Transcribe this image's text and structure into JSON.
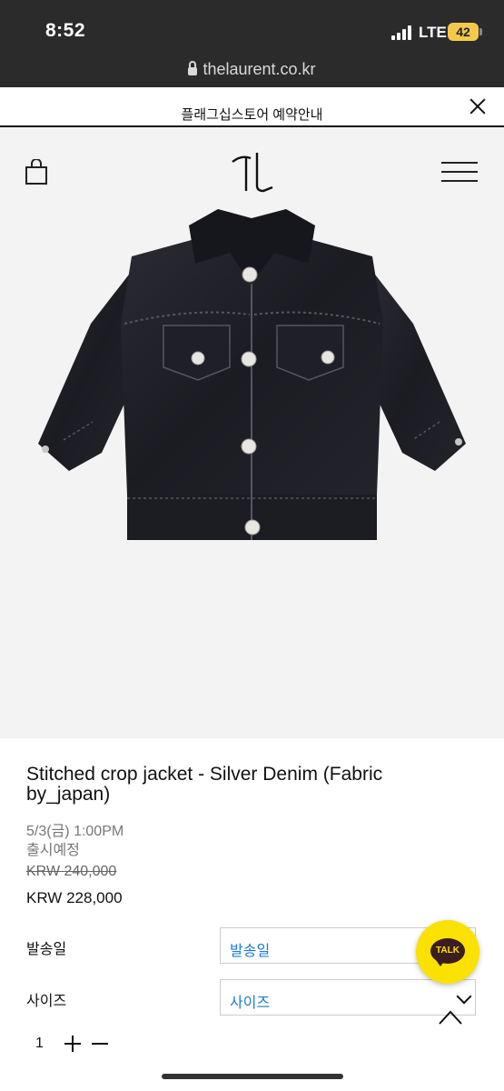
{
  "status_bar": {
    "time": "8:52",
    "network": "LTE",
    "battery": "42"
  },
  "browser": {
    "url": "thelaurent.co.kr"
  },
  "notice": {
    "text": "플래그십스토어 예약안내"
  },
  "product": {
    "title": "Stitched crop jacket - Silver Denim (Fabric by_japan)",
    "release_date": "5/3(금) 1:00PM",
    "release_note": "출시예정",
    "original_price": "KRW 240,000",
    "price": "KRW 228,000"
  },
  "options": {
    "ship_label": "발송일",
    "ship_value": "발송일",
    "size_label": "사이즈",
    "size_value": "사이즈"
  },
  "quantity": {
    "value": "1"
  },
  "chat": {
    "label": "TALK"
  },
  "colors": {
    "accent_link": "#1a7bd6",
    "kakao": "#fae100",
    "status_bg": "#2b2b2b"
  },
  "icons": [
    "lock-icon",
    "close-icon",
    "bag-icon",
    "logo",
    "menu-icon",
    "chevron-down-icon",
    "plus-icon",
    "minus-icon",
    "talk-icon",
    "up-arrow-icon"
  ]
}
